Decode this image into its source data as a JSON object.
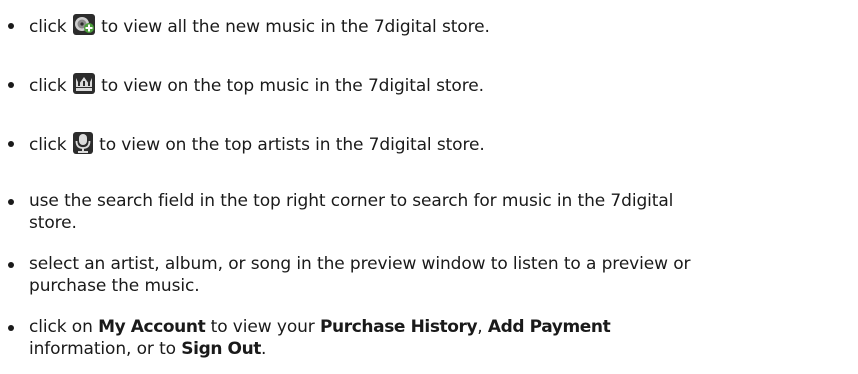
{
  "items": [
    {
      "pre": "click",
      "icon": "new-music-plus-icon",
      "post": "to view all the new music in the 7digital store."
    },
    {
      "pre": "click",
      "icon": "top-music-crown-icon",
      "post": "to view on the top music in the 7digital store."
    },
    {
      "pre": "click",
      "icon": "top-artists-microphone-icon",
      "post": "to view on the top artists in the 7digital store."
    },
    {
      "line1": "use the search field in the top right corner to search for music in the 7digital",
      "line2": "store."
    },
    {
      "line1": "select an artist, album, or song in the preview window to listen to a preview or",
      "line2": "purchase the music."
    },
    {
      "t1": "click on",
      "b1": "My Account",
      "t2": "to view your",
      "b2": "Purchase History",
      "t3": ",",
      "b3": "Add Payment",
      "line2_pre": "information, or to",
      "b4": "Sign Out",
      "t4": "."
    }
  ],
  "icon_colors": {
    "icon_background": "#2c2c2c",
    "icon_accent": "#4a9e3a",
    "icon_light": "#e8e8e8"
  }
}
